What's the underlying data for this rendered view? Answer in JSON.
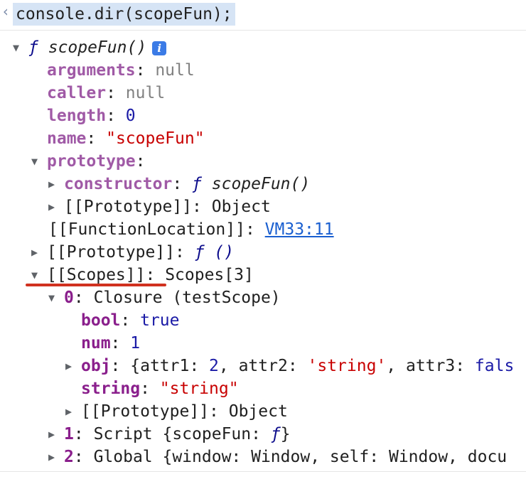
{
  "command": "console.dir(scopeFun);",
  "fn_signature": {
    "f": "ƒ",
    "name": "scopeFun()"
  },
  "props": {
    "arguments": {
      "key": "arguments",
      "value": "null"
    },
    "caller": {
      "key": "caller",
      "value": "null"
    },
    "length": {
      "key": "length",
      "value": "0"
    },
    "name": {
      "key": "name",
      "value": "\"scopeFun\""
    },
    "prototype": {
      "key": "prototype"
    },
    "constructor": {
      "key": "constructor",
      "f": "ƒ",
      "value": "scopeFun()"
    },
    "proto_inner": {
      "key": "[[Prototype]]",
      "value": "Object"
    },
    "function_location": {
      "key": "[[FunctionLocation]]",
      "value": "VM33:11"
    },
    "proto_outer": {
      "key": "[[Prototype]]",
      "value": "ƒ ()"
    },
    "scopes": {
      "key": "[[Scopes]]",
      "value": "Scopes[3]"
    }
  },
  "scope0": {
    "index": "0",
    "value": "Closure (testScope)",
    "bool": {
      "key": "bool",
      "value": "true"
    },
    "num": {
      "key": "num",
      "value": "1"
    },
    "obj": {
      "key": "obj",
      "open": "{attr1: ",
      "v1": "2",
      "sep1": ", attr2: ",
      "v2": "'string'",
      "sep2": ", attr3: ",
      "v3": "fals"
    },
    "string": {
      "key": "string",
      "value": "\"string\""
    },
    "proto": {
      "key": "[[Prototype]]",
      "value": "Object"
    }
  },
  "scope1": {
    "index": "1",
    "value": "Script {scopeFun: ",
    "f": "ƒ",
    "close": "}"
  },
  "scope2": {
    "index": "2",
    "value": "Global {window: Window, self: Window, docu"
  },
  "icons": {
    "expanded": "▼",
    "collapsed": "▶",
    "prompt": "‹",
    "info": "i"
  },
  "colors": {
    "key": "#8a1f8c",
    "number": "#1a1aa6",
    "string": "#c80000",
    "link": "#1a5fd0",
    "highlight": "#d6e4f5",
    "annotation": "#d0311f"
  }
}
